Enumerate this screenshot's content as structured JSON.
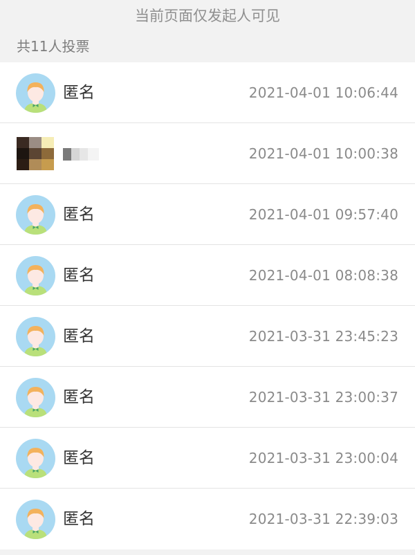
{
  "header": {
    "notice": "当前页面仅发起人可见",
    "count_label": "共11人投票"
  },
  "colors": {
    "avatar_bg": "#a9d9f2",
    "hair": "#f3b25c",
    "face": "#fde9e3",
    "shirt": "#b9e07a",
    "bow": "#4aa36a"
  },
  "voters": [
    {
      "name": "匿名",
      "time": "2021-04-01 10:06:44",
      "avatar": "default-avatar"
    },
    {
      "name": "",
      "time": "2021-04-01 10:00:38",
      "avatar": "pixelated-avatar"
    },
    {
      "name": "匿名",
      "time": "2021-04-01 09:57:40",
      "avatar": "default-avatar"
    },
    {
      "name": "匿名",
      "time": "2021-04-01 08:08:38",
      "avatar": "default-avatar"
    },
    {
      "name": "匿名",
      "time": "2021-03-31 23:45:23",
      "avatar": "default-avatar"
    },
    {
      "name": "匿名",
      "time": "2021-03-31 23:00:37",
      "avatar": "default-avatar"
    },
    {
      "name": "匿名",
      "time": "2021-03-31 23:00:04",
      "avatar": "default-avatar"
    },
    {
      "name": "匿名",
      "time": "2021-03-31 22:39:03",
      "avatar": "default-avatar"
    }
  ]
}
